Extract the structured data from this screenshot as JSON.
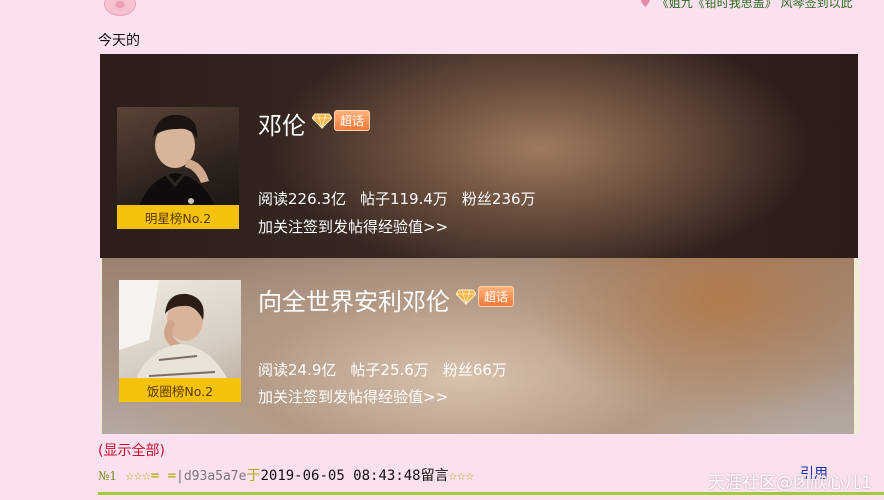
{
  "top": {
    "link_text": "《姐九《钳时我思盖》 风琴签到以此"
  },
  "today_label": "今天的",
  "cards": [
    {
      "title": "邓伦",
      "tag": "超话",
      "rank": "明星榜No.2",
      "stats": {
        "read": "阅读226.3亿",
        "posts": "帖子119.4万",
        "fans": "粉丝236万"
      },
      "follow": "加关注签到发帖得经验值>>"
    },
    {
      "title": "向全世界安利邓伦",
      "tag": "超话",
      "rank": "饭圈榜No.2",
      "stats": {
        "read": "阅读24.9亿",
        "posts": "帖子25.6万",
        "fans": "粉丝66万"
      },
      "follow": "加关注签到发帖得经验值>>"
    }
  ],
  "show_all": "(显示全部)",
  "reply": {
    "num": "№1",
    "stars_left": "☆☆☆= =",
    "user_id": "|d93a5a7e",
    "yu": "于",
    "time": "2019-06-05 08:43:48",
    "msg": "留言",
    "stars_right": "☆☆☆"
  },
  "quote_link": "引用",
  "watermark": "天涯社区@团欣心儿1",
  "colors": {
    "background": "#fbe0f0",
    "badge": "#f4c20d",
    "show_all": "#c8102e",
    "divider": "#9fcc3a"
  }
}
